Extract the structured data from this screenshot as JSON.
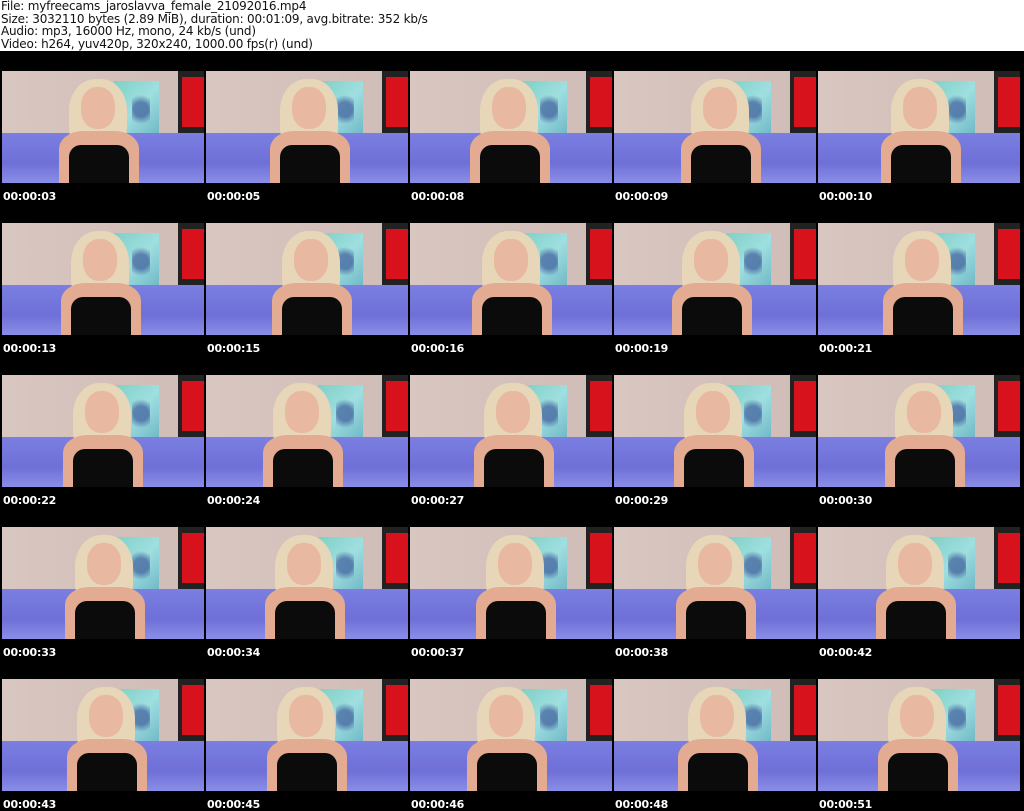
{
  "header": {
    "file": "File: myfreecams_jaroslavva_female_21092016.mp4",
    "size": "Size: 3032110 bytes (2.89 MiB), duration: 00:01:09, avg.bitrate: 352 kb/s",
    "audio": "Audio: mp3, 16000 Hz, mono, 24 kb/s (und)",
    "video": "Video: h264, yuv420p, 320x240, 1000.00 fps(r) (und)"
  },
  "thumbnails": [
    "00:00:03",
    "00:00:05",
    "00:00:08",
    "00:00:09",
    "00:00:10",
    "00:00:13",
    "00:00:15",
    "00:00:16",
    "00:00:19",
    "00:00:21",
    "00:00:22",
    "00:00:24",
    "00:00:27",
    "00:00:29",
    "00:00:30",
    "00:00:33",
    "00:00:34",
    "00:00:37",
    "00:00:38",
    "00:00:42",
    "00:00:43",
    "00:00:45",
    "00:00:46",
    "00:00:48",
    "00:00:51"
  ]
}
